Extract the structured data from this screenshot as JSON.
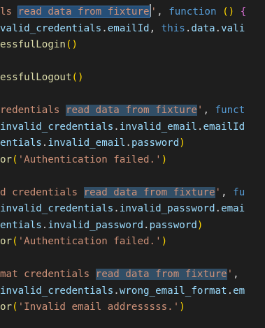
{
  "editor": {
    "lines": [
      [
        [
          "str",
          "ls "
        ],
        [
          "sel",
          "read data from fixture"
        ],
        [
          "cursor",
          ""
        ],
        [
          "str",
          "'"
        ],
        [
          "plain",
          ", "
        ],
        [
          "kw",
          "function"
        ],
        [
          "plain",
          " "
        ],
        [
          "paren",
          "()"
        ],
        [
          "plain",
          " "
        ],
        [
          "brace",
          "{"
        ]
      ],
      [
        [
          "prop",
          "valid_credentials"
        ],
        [
          "plain",
          "."
        ],
        [
          "prop",
          "emailId"
        ],
        [
          "plain",
          ", "
        ],
        [
          "kw",
          "this"
        ],
        [
          "plain",
          "."
        ],
        [
          "prop",
          "data"
        ],
        [
          "plain",
          "."
        ],
        [
          "prop",
          "vali"
        ]
      ],
      [
        [
          "fn",
          "essfulLogin"
        ],
        [
          "paren",
          "()"
        ]
      ],
      [],
      [
        [
          "fn",
          "essfulLogout"
        ],
        [
          "paren",
          "()"
        ]
      ],
      [],
      [
        [
          "str",
          "redentials "
        ],
        [
          "hl",
          "read data from fixture"
        ],
        [
          "str",
          "'"
        ],
        [
          "plain",
          ", "
        ],
        [
          "kw",
          "funct"
        ]
      ],
      [
        [
          "prop",
          "invalid_credentials"
        ],
        [
          "plain",
          "."
        ],
        [
          "prop",
          "invalid_email"
        ],
        [
          "plain",
          "."
        ],
        [
          "prop",
          "emailId"
        ]
      ],
      [
        [
          "prop",
          "entials"
        ],
        [
          "plain",
          "."
        ],
        [
          "prop",
          "invalid_email"
        ],
        [
          "plain",
          "."
        ],
        [
          "prop",
          "password"
        ],
        [
          "paren",
          ")"
        ]
      ],
      [
        [
          "fn",
          "or"
        ],
        [
          "paren",
          "("
        ],
        [
          "str",
          "'Authentication failed.'"
        ],
        [
          "paren",
          ")"
        ]
      ],
      [],
      [
        [
          "str",
          "d credentials "
        ],
        [
          "hl",
          "read data from fixture"
        ],
        [
          "str",
          "'"
        ],
        [
          "plain",
          ", "
        ],
        [
          "kw",
          "fu"
        ]
      ],
      [
        [
          "prop",
          "invalid_credentials"
        ],
        [
          "plain",
          "."
        ],
        [
          "prop",
          "invalid_password"
        ],
        [
          "plain",
          "."
        ],
        [
          "prop",
          "emai"
        ]
      ],
      [
        [
          "prop",
          "entials"
        ],
        [
          "plain",
          "."
        ],
        [
          "prop",
          "invalid_password"
        ],
        [
          "plain",
          "."
        ],
        [
          "prop",
          "password"
        ],
        [
          "paren",
          ")"
        ]
      ],
      [
        [
          "fn",
          "or"
        ],
        [
          "paren",
          "("
        ],
        [
          "str",
          "'Authentication failed.'"
        ],
        [
          "paren",
          ")"
        ]
      ],
      [],
      [
        [
          "str",
          "mat credentials "
        ],
        [
          "hl",
          "read data from fixture"
        ],
        [
          "str",
          "'"
        ],
        [
          "plain",
          ","
        ]
      ],
      [
        [
          "prop",
          "invalid_credentials"
        ],
        [
          "plain",
          "."
        ],
        [
          "prop",
          "wrong_email_format"
        ],
        [
          "plain",
          "."
        ],
        [
          "prop",
          "em"
        ]
      ],
      [
        [
          "fn",
          "or"
        ],
        [
          "paren",
          "("
        ],
        [
          "str",
          "'Invalid email addresssss.'"
        ],
        [
          "paren",
          ")"
        ]
      ]
    ]
  },
  "colors": {
    "background": "#1e1e1e",
    "string": "#ce9178",
    "function": "#dcdcaa",
    "property": "#9cdcfe",
    "keyword": "#569cd6",
    "brace": "#da70d6",
    "paren": "#ffd700",
    "selection": "#264f78",
    "highlight": "#314e66"
  }
}
